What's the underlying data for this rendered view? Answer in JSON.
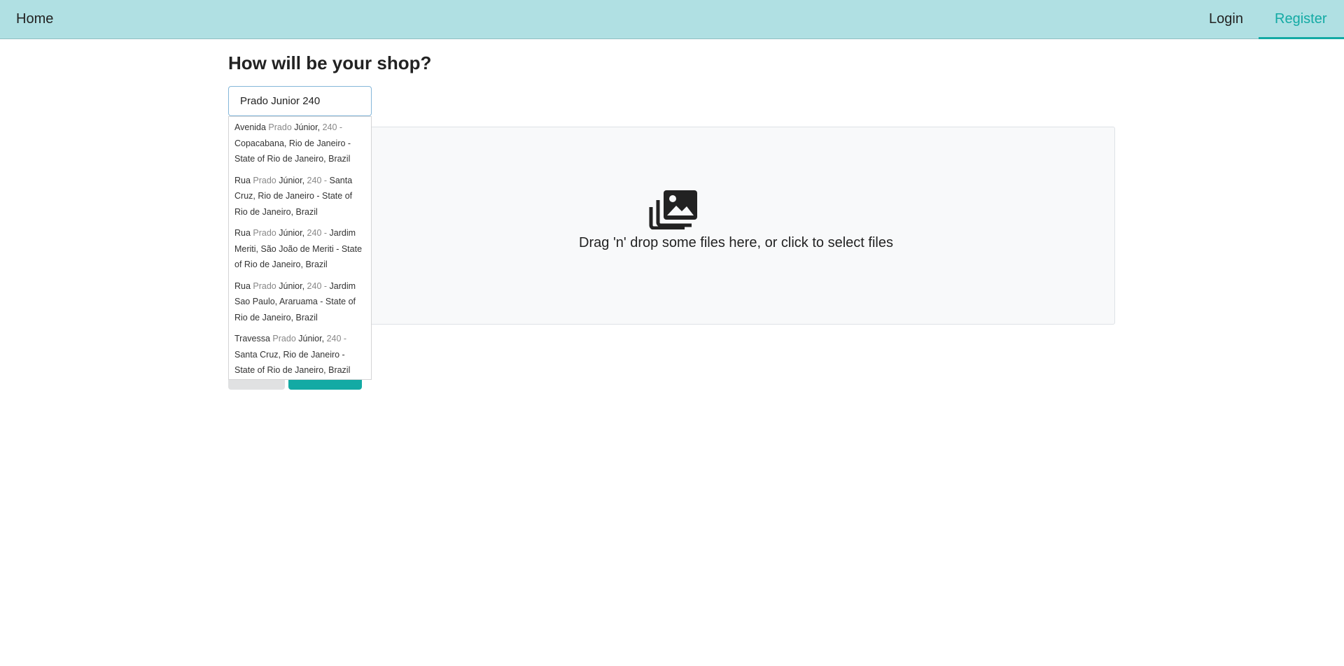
{
  "nav": {
    "home_label": "Home",
    "login_label": "Login",
    "register_label": "Register"
  },
  "page": {
    "title": "How will be your shop?"
  },
  "address_input": {
    "value": "Prado Junior 240"
  },
  "suggestions": [
    {
      "prefix": "Avenida ",
      "match": "Prado",
      "mid": " Júnior,",
      "num": " 240 -",
      "rest": " Copacabana, Rio de Janeiro - State of Rio de Janeiro, Brazil"
    },
    {
      "prefix": "Rua ",
      "match": "Prado",
      "mid": " Júnior,",
      "num": " 240 -",
      "rest": " Santa Cruz, Rio de Janeiro - State of Rio de Janeiro, Brazil"
    },
    {
      "prefix": "Rua ",
      "match": "Prado",
      "mid": " Júnior,",
      "num": " 240 -",
      "rest": " Jardim Meriti, São João de Meriti - State of Rio de Janeiro, Brazil"
    },
    {
      "prefix": "Rua ",
      "match": "Prado",
      "mid": " Júnior,",
      "num": " 240 -",
      "rest": " Jardim Sao Paulo, Araruama - State of Rio de Janeiro, Brazil"
    },
    {
      "prefix": "Travessa ",
      "match": "Prado",
      "mid": " Júnior,",
      "num": " 240 -",
      "rest": " Santa Cruz, Rio de Janeiro - State of Rio de Janeiro, Brazil"
    }
  ],
  "dropzone": {
    "icon": "images-icon",
    "text": "Drag 'n' drop some files here, or click to select files"
  },
  "colors": {
    "navbar_bg": "#b0e0e3",
    "accent": "#13aaa4",
    "back_button": "#e0e1e2"
  }
}
